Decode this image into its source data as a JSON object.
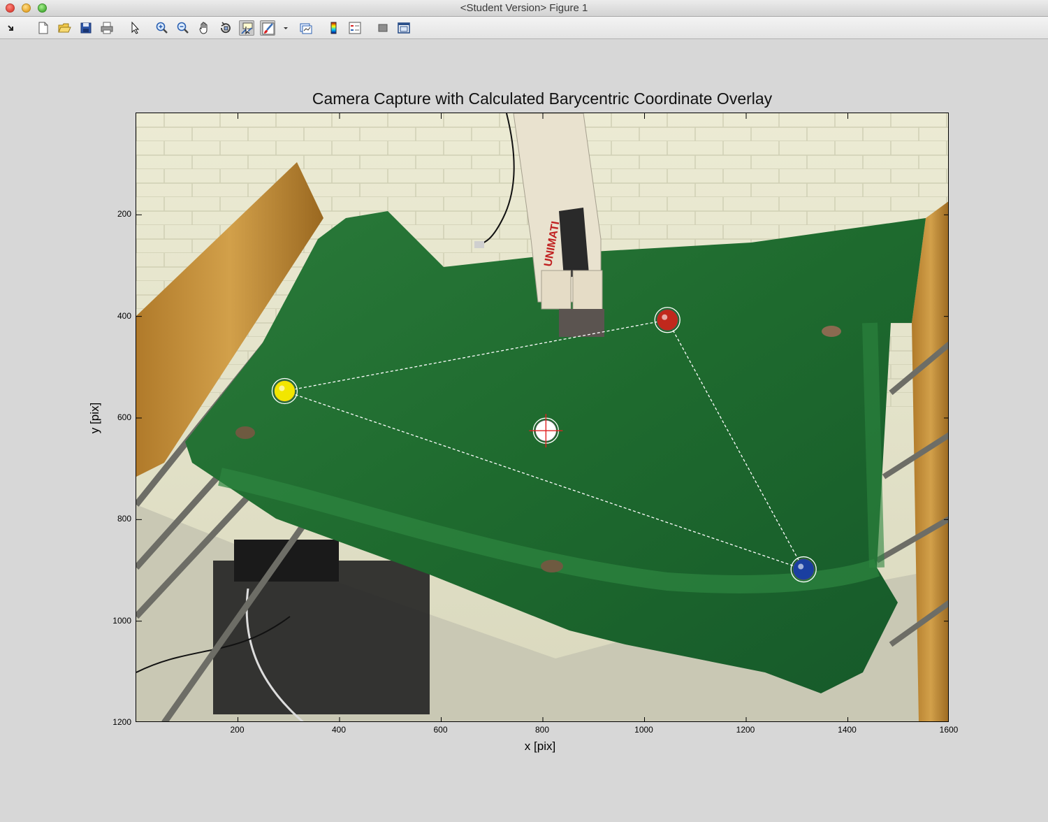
{
  "window": {
    "title": "<Student Version> Figure 1"
  },
  "toolbar": {
    "buttons": [
      {
        "name": "dock-button",
        "icon": "dock-arrow-icon"
      },
      {
        "name": "new-figure-button",
        "icon": "new-file-icon"
      },
      {
        "name": "open-file-button",
        "icon": "open-folder-icon"
      },
      {
        "name": "save-figure-button",
        "icon": "save-disk-icon"
      },
      {
        "name": "print-figure-button",
        "icon": "printer-icon"
      },
      {
        "name": "edit-plot-button",
        "icon": "arrow-pointer-icon"
      },
      {
        "name": "zoom-in-button",
        "icon": "zoom-in-icon"
      },
      {
        "name": "zoom-out-button",
        "icon": "zoom-out-icon"
      },
      {
        "name": "pan-button",
        "icon": "hand-icon"
      },
      {
        "name": "rotate-3d-button",
        "icon": "rotate-3d-icon"
      },
      {
        "name": "data-cursor-button",
        "icon": "data-cursor-icon"
      },
      {
        "name": "brush-button",
        "icon": "brush-icon"
      },
      {
        "name": "brush-dropdown-button",
        "icon": "dropdown-arrow-icon"
      },
      {
        "name": "link-plot-button",
        "icon": "link-plot-icon"
      },
      {
        "name": "insert-colorbar-button",
        "icon": "colorbar-icon"
      },
      {
        "name": "insert-legend-button",
        "icon": "legend-icon"
      },
      {
        "name": "hide-plot-tools-button",
        "icon": "hide-tools-icon"
      },
      {
        "name": "show-plot-tools-button",
        "icon": "show-tools-icon"
      }
    ]
  },
  "plot": {
    "title": "Camera Capture with Calculated Barycentric Coordinate Overlay",
    "xlabel": "x [pix]",
    "ylabel": "y [pix]",
    "xlim": [
      0,
      1600
    ],
    "ylim": [
      0,
      1200
    ],
    "y_reversed": true,
    "x_ticks": [
      200,
      400,
      600,
      800,
      1000,
      1200,
      1400,
      1600
    ],
    "y_ticks": [
      200,
      400,
      600,
      800,
      1000,
      1200
    ],
    "background": "camera image of robot arm above green felt pool table"
  },
  "chart_data": {
    "type": "scatter",
    "title": "Camera Capture with Calculated Barycentric Coordinate Overlay",
    "xlabel": "x [pix]",
    "ylabel": "y [pix]",
    "xlim": [
      0,
      1600
    ],
    "ylim": [
      1200,
      0
    ],
    "series": [
      {
        "color": "#f2e600",
        "points": [
          {
            "x": 292,
            "y": 547
          }
        ]
      },
      {
        "color": "#c0281c",
        "points": [
          {
            "x": 1045,
            "y": 407
          }
        ]
      },
      {
        "color": "#1a3fa0",
        "points": [
          {
            "x": 1313,
            "y": 898
          }
        ]
      },
      {
        "color": "#ffffff",
        "points": [
          {
            "x": 806,
            "y": 625
          }
        ]
      }
    ],
    "triangle_vertices": [
      {
        "x": 292,
        "y": 547
      },
      {
        "x": 1045,
        "y": 407
      },
      {
        "x": 1313,
        "y": 898
      }
    ],
    "crosshair": {
      "x": 806,
      "y": 625,
      "color": "#e02020"
    }
  }
}
